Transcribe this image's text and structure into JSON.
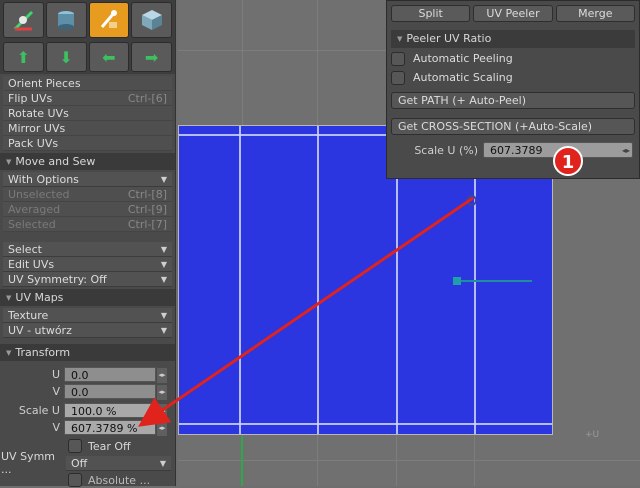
{
  "left_panel": {
    "uv_tools": [
      "Orient Pieces",
      "Flip UVs",
      "Rotate UVs",
      "Mirror UVs",
      "Pack UVs"
    ],
    "flip_shortcut": "Ctrl-[6]",
    "move_sew": {
      "header": "Move and Sew",
      "option": "With Options",
      "items": [
        {
          "label": "Unselected",
          "shortcut": "Ctrl-[8]"
        },
        {
          "label": "Averaged",
          "shortcut": "Ctrl-[9]"
        },
        {
          "label": "Selected",
          "shortcut": "Ctrl-[7]"
        }
      ]
    },
    "dropdowns": [
      "Select",
      "Edit UVs",
      "UV Symmetry: Off"
    ],
    "uv_maps": {
      "header": "UV Maps",
      "items": [
        "Texture",
        "UV - utwórz"
      ]
    },
    "transform": {
      "header": "Transform",
      "u_label": "U",
      "u_value": "0.0",
      "v_label": "V",
      "v_value": "0.0",
      "scale_label": "Scale U",
      "scale_u": "100.0 %",
      "scale_v_label": "V",
      "scale_v": "607.3789 %",
      "tear_off": "Tear Off",
      "uv_symm_label": "UV Symm ...",
      "uv_symm_value": "Off",
      "bottom_partial": "Absolute ..."
    }
  },
  "popup": {
    "buttons": [
      "Split",
      "UV Peeler",
      "Merge"
    ],
    "section": "Peeler UV Ratio",
    "auto_peeling": "Automatic Peeling",
    "auto_scaling": "Automatic Scaling",
    "get_path": "Get PATH (+ Auto-Peel)",
    "get_cross": "Get CROSS-SECTION (+Auto-Scale)",
    "scale_label": "Scale U (%)",
    "scale_value": "607.3789",
    "badge": "1"
  },
  "viewport": {
    "axis_label": "+U"
  },
  "colors": {
    "uv_blue": "#2b35e0",
    "accent_orange": "#e79b1f",
    "badge_red": "#e0231c",
    "arrow_red": "#e0231c"
  }
}
